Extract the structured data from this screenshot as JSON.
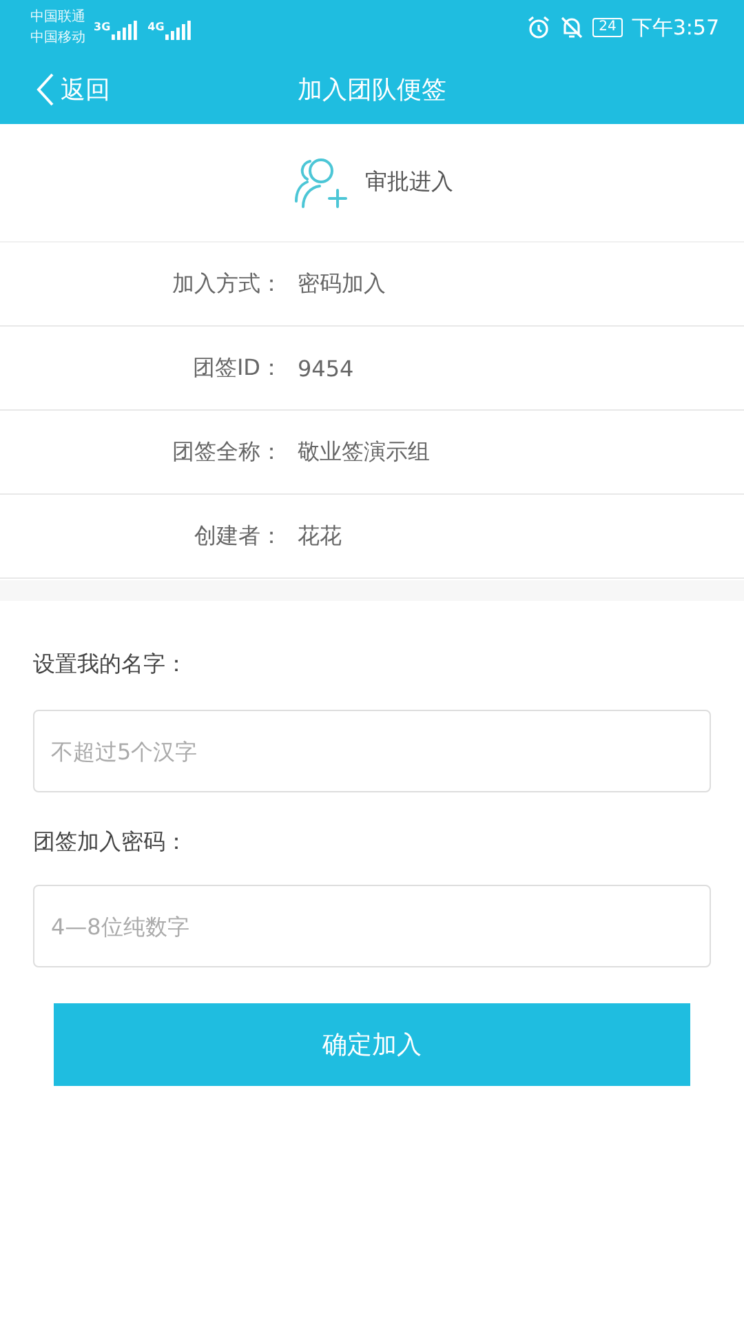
{
  "status_bar": {
    "carriers": [
      "中国联通",
      "中国移动"
    ],
    "networks": [
      "3G",
      "4G"
    ],
    "battery": "24",
    "time": "下午3:57"
  },
  "nav": {
    "back": "返回",
    "title": "加入团队便签"
  },
  "approval": {
    "label": "审批进入"
  },
  "info_rows": [
    {
      "label": "加入方式：",
      "value": "密码加入"
    },
    {
      "label": "团签ID：",
      "value": "9454"
    },
    {
      "label": "团签全称：",
      "value": "敬业签演示组"
    },
    {
      "label": "创建者：",
      "value": "花花"
    }
  ],
  "form": [
    {
      "label": "设置我的名字：",
      "placeholder": "不超过5个汉字"
    },
    {
      "label": "团签加入密码：",
      "placeholder": "4—8位纯数字"
    }
  ],
  "submit": "确定加入"
}
